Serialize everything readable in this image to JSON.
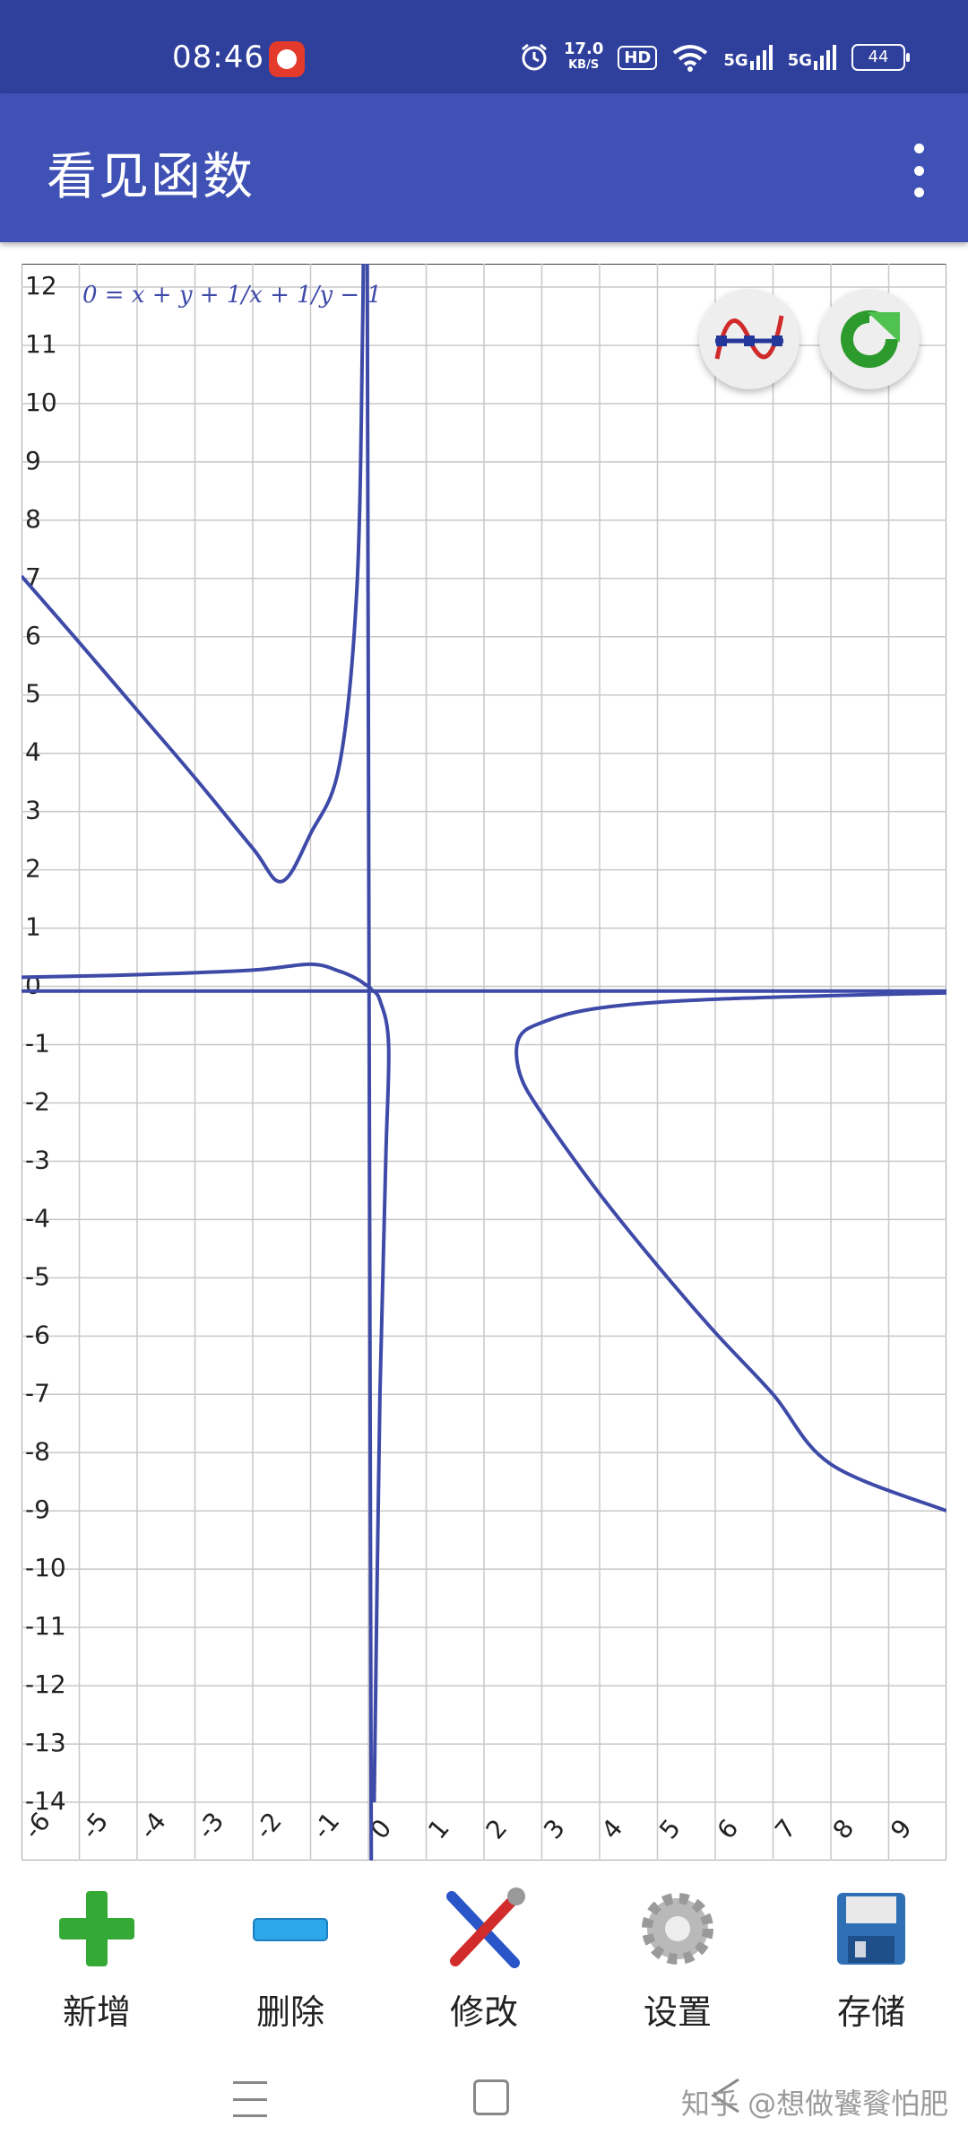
{
  "status_bar": {
    "time": "08:46",
    "net_speed_value": "17.0",
    "net_speed_unit": "KB/S",
    "hd_label": "HD",
    "signal1": "5G",
    "signal2": "5G",
    "battery": "44"
  },
  "app_bar": {
    "title": "看见函数"
  },
  "graph": {
    "equation": "0 = x + y + 1/x + 1/y − 1",
    "x_range": [
      -6,
      10
    ],
    "y_range": [
      -15,
      12.4
    ],
    "curve_color": "#3e4aa8",
    "grid_color": "#c8c8c8"
  },
  "chart_data": {
    "type": "line",
    "title": "0 = x + y + 1/x + 1/y − 1",
    "xlabel": "",
    "ylabel": "",
    "x_ticks": [
      "-6",
      "-5",
      "-4",
      "-3",
      "-2",
      "-1",
      "0",
      "1",
      "2",
      "3",
      "4",
      "5",
      "6",
      "7",
      "8",
      "9"
    ],
    "y_ticks": [
      "12",
      "11",
      "10",
      "9",
      "8",
      "7",
      "6",
      "5",
      "4",
      "3",
      "2",
      "1",
      "0",
      "-1",
      "-2",
      "-3",
      "-4",
      "-5",
      "-6",
      "-7",
      "-8",
      "-9",
      "-10",
      "-11",
      "-12",
      "-13",
      "-14"
    ],
    "xlim": [
      -6,
      10
    ],
    "ylim": [
      -15,
      12.4
    ],
    "grid": true,
    "series": [
      {
        "points": [
          [
            -6,
            7.04
          ],
          [
            -5,
            5.9
          ],
          [
            -4,
            4.74
          ],
          [
            -3,
            3.58
          ],
          [
            -2,
            2.37
          ],
          [
            -1.5,
            1.8
          ],
          [
            -1,
            2.62
          ],
          [
            -0.5,
            3.8
          ],
          [
            -0.2,
            6.8
          ],
          [
            -0.1,
            11.3
          ],
          [
            -0.08,
            14
          ]
        ]
      },
      {
        "points": [
          [
            -6,
            0.157
          ],
          [
            -4,
            0.2
          ],
          [
            -2,
            0.28
          ],
          [
            -1,
            0.38
          ],
          [
            -0.5,
            0.26
          ],
          [
            -0.2,
            0.13
          ],
          [
            -0.05,
            0.03
          ],
          [
            0,
            0
          ]
        ]
      },
      {
        "points": [
          [
            0,
            0
          ],
          [
            0.05,
            -0.05
          ],
          [
            0.2,
            -0.24
          ],
          [
            0.35,
            -1.0
          ],
          [
            0.3,
            -3.0
          ],
          [
            0.2,
            -7.0
          ],
          [
            0.1,
            -14.0
          ]
        ]
      },
      {
        "points": [
          [
            10,
            -0.11
          ],
          [
            6,
            -0.22
          ],
          [
            4,
            -0.37
          ],
          [
            3,
            -0.62
          ],
          [
            2.6,
            -0.9
          ],
          [
            2.62,
            -1.5
          ],
          [
            3,
            -2.18
          ],
          [
            4,
            -3.56
          ],
          [
            5,
            -4.79
          ],
          [
            6,
            -5.94
          ],
          [
            7,
            -7.0
          ],
          [
            8,
            -8.2
          ],
          [
            10,
            -9.0
          ]
        ]
      },
      {
        "points": [
          [
            -6,
            -0.08
          ],
          [
            10,
            -0.08
          ]
        ]
      },
      {
        "points": [
          [
            -0.02,
            12.4
          ],
          [
            0.05,
            -15
          ]
        ]
      }
    ]
  },
  "fab": {
    "function_icon": "sine-wave-icon",
    "refresh_icon": "refresh-icon"
  },
  "toolbar": {
    "add_label": "新增",
    "delete_label": "删除",
    "edit_label": "修改",
    "settings_label": "设置",
    "save_label": "存储"
  },
  "nav": {
    "watermark": "知乎 @想做饕餮怕肥"
  }
}
